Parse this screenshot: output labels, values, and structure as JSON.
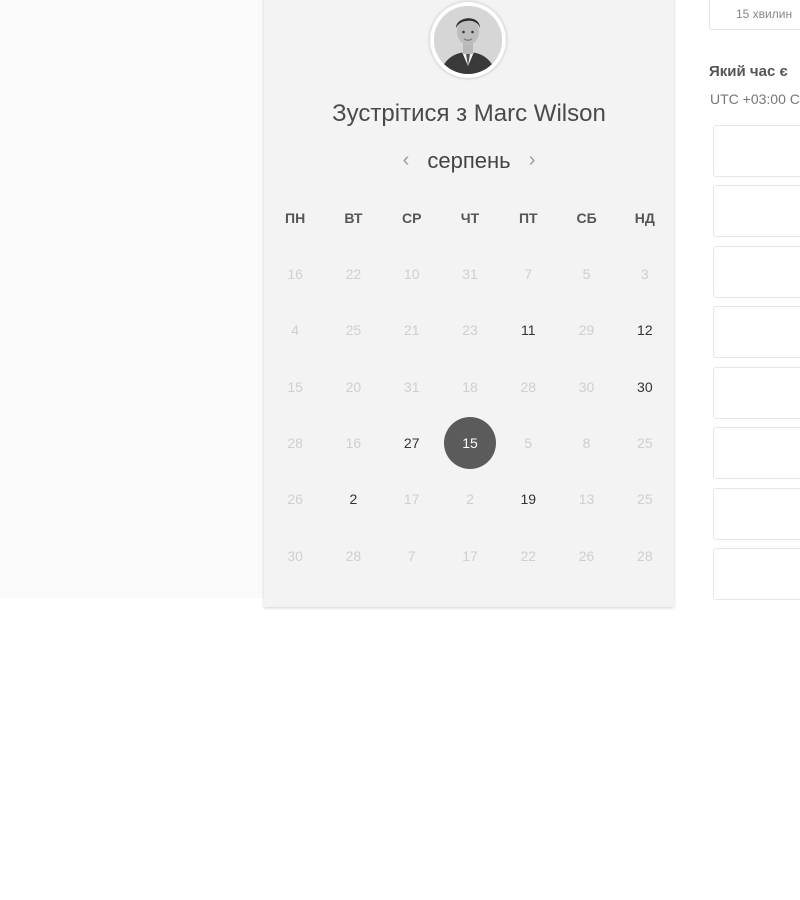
{
  "host": {
    "meet_title": "Зустрітися з Marc Wilson"
  },
  "calendar": {
    "month": "серпень",
    "weekdays": [
      "ПН",
      "ВТ",
      "СР",
      "ЧТ",
      "ПТ",
      "СБ",
      "НД"
    ],
    "weeks": [
      [
        {
          "d": "16",
          "a": false
        },
        {
          "d": "22",
          "a": false
        },
        {
          "d": "10",
          "a": false
        },
        {
          "d": "31",
          "a": false
        },
        {
          "d": "7",
          "a": false
        },
        {
          "d": "5",
          "a": false
        },
        {
          "d": "3",
          "a": false
        }
      ],
      [
        {
          "d": "4",
          "a": false
        },
        {
          "d": "25",
          "a": false
        },
        {
          "d": "21",
          "a": false
        },
        {
          "d": "23",
          "a": false
        },
        {
          "d": "11",
          "a": true
        },
        {
          "d": "29",
          "a": false
        },
        {
          "d": "12",
          "a": true
        }
      ],
      [
        {
          "d": "15",
          "a": false
        },
        {
          "d": "20",
          "a": false
        },
        {
          "d": "31",
          "a": false
        },
        {
          "d": "18",
          "a": false
        },
        {
          "d": "28",
          "a": false
        },
        {
          "d": "30",
          "a": false
        },
        {
          "d": "30",
          "a": true
        }
      ],
      [
        {
          "d": "28",
          "a": false
        },
        {
          "d": "16",
          "a": false
        },
        {
          "d": "27",
          "a": true
        },
        {
          "d": "15",
          "a": true,
          "s": true
        },
        {
          "d": "5",
          "a": false
        },
        {
          "d": "8",
          "a": false
        },
        {
          "d": "25",
          "a": false
        }
      ],
      [
        {
          "d": "26",
          "a": false
        },
        {
          "d": "2",
          "a": true
        },
        {
          "d": "17",
          "a": false
        },
        {
          "d": "2",
          "a": false
        },
        {
          "d": "19",
          "a": true
        },
        {
          "d": "13",
          "a": false
        },
        {
          "d": "25",
          "a": false
        }
      ],
      [
        {
          "d": "30",
          "a": false
        },
        {
          "d": "28",
          "a": false
        },
        {
          "d": "7",
          "a": false
        },
        {
          "d": "17",
          "a": false
        },
        {
          "d": "22",
          "a": false
        },
        {
          "d": "26",
          "a": false
        },
        {
          "d": "28",
          "a": false
        }
      ]
    ]
  },
  "right_panel": {
    "duration": "15 хвилин",
    "tz_question": "Який час є",
    "tz_value": "UTC +03:00 С"
  }
}
